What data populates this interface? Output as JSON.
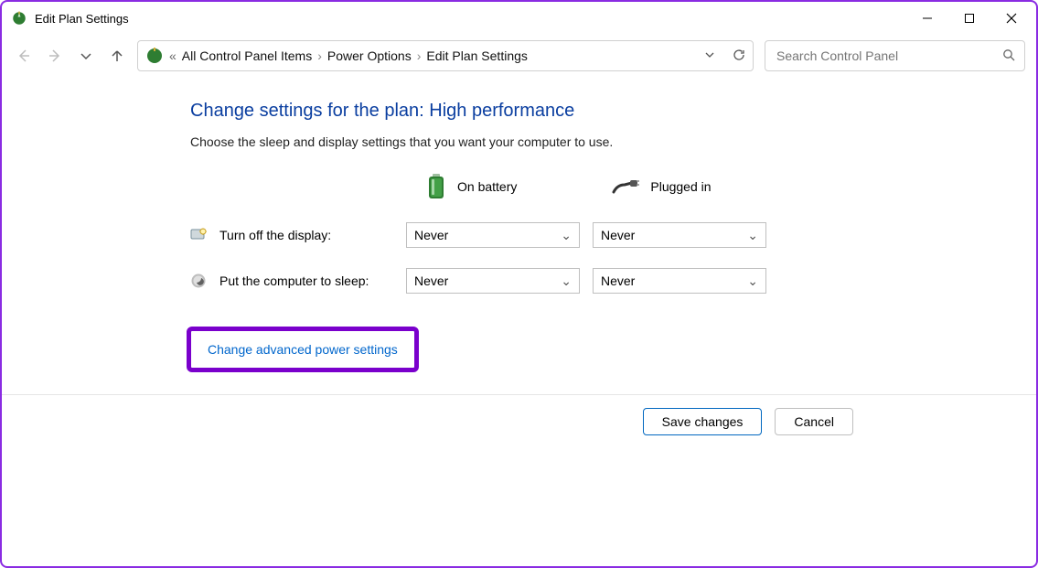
{
  "window": {
    "title": "Edit Plan Settings"
  },
  "breadcrumb": {
    "items": [
      "All Control Panel Items",
      "Power Options",
      "Edit Plan Settings"
    ]
  },
  "search": {
    "placeholder": "Search Control Panel"
  },
  "page": {
    "heading": "Change settings for the plan: High performance",
    "subtext": "Choose the sleep and display settings that you want your computer to use.",
    "col_battery": "On battery",
    "col_plugged": "Plugged in",
    "rows": [
      {
        "label": "Turn off the display:",
        "battery": "Never",
        "plugged": "Never"
      },
      {
        "label": "Put the computer to sleep:",
        "battery": "Never",
        "plugged": "Never"
      }
    ],
    "advanced_link": "Change advanced power settings"
  },
  "footer": {
    "save": "Save changes",
    "cancel": "Cancel"
  }
}
